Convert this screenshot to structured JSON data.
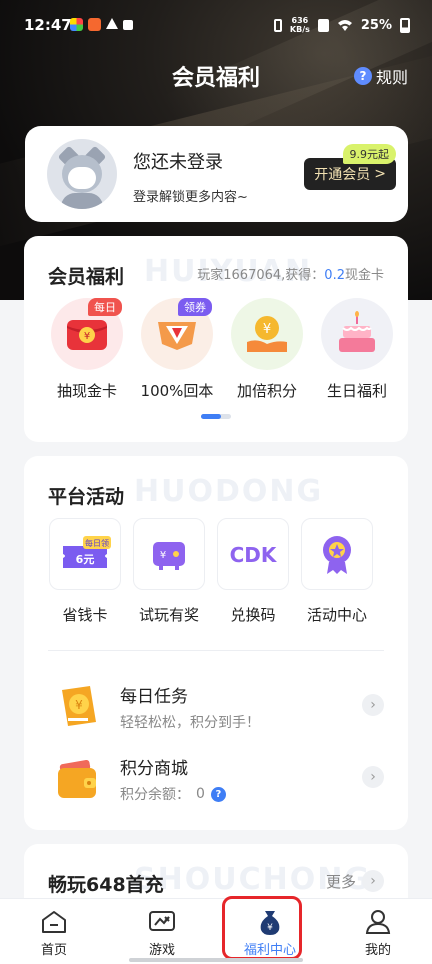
{
  "status_bar": {
    "time": "12:47",
    "net_speed_value": "636",
    "net_speed_unit": "KB/s",
    "battery": "25%"
  },
  "header": {
    "title": "会员福利",
    "rules_label": "规则",
    "rules_icon": "?"
  },
  "login_card": {
    "title": "您还未登录",
    "subtitle": "登录解锁更多内容~",
    "vip_price_tag": "9.9元起",
    "vip_button": "开通会员",
    "vip_button_chevron": ">"
  },
  "benefits": {
    "title": "会员福利",
    "watermark": "HUIYUAN",
    "note_prefix": "玩家1667064,获得：",
    "note_value": "0.2",
    "note_suffix": "现金卡",
    "items": [
      {
        "label": "抽现金卡",
        "badge": "每日",
        "icon": "red-envelope-icon"
      },
      {
        "label": "100%回本",
        "badge": "领券",
        "icon": "diamond-icon"
      },
      {
        "label": "加倍积分",
        "badge": "",
        "icon": "coin-hand-icon"
      },
      {
        "label": "生日福利",
        "badge": "",
        "icon": "birthday-cake-icon"
      }
    ],
    "page_indicator": {
      "current": 1,
      "total": 2
    }
  },
  "platform": {
    "title": "平台活动",
    "watermark": "HUODONG",
    "items": [
      {
        "label": "省钱卡",
        "badge": "每日领",
        "ticket_text": "6元",
        "icon": "ticket-icon"
      },
      {
        "label": "试玩有奖",
        "icon": "gamepad-icon"
      },
      {
        "label": "兑换码",
        "icon_text": "CDK",
        "icon": "cdk-icon"
      },
      {
        "label": "活动中心",
        "icon": "medal-icon"
      }
    ],
    "tasks": [
      {
        "title": "每日任务",
        "subtitle": "轻轻松松，积分到手！",
        "icon": "task-coin-icon"
      },
      {
        "title": "积分商城",
        "subtitle": "积分余额：",
        "balance": "0",
        "icon": "wallet-icon"
      }
    ],
    "chevron": "›",
    "help_icon": "?"
  },
  "first_charge": {
    "title": "畅玩648首充",
    "watermark": "SHOUCHONG",
    "more_label": "更多",
    "chevron": "›"
  },
  "tab_bar": {
    "tabs": [
      {
        "label": "首页",
        "icon": "home-icon"
      },
      {
        "label": "游戏",
        "icon": "game-icon"
      },
      {
        "label": "福利中心",
        "icon": "welfare-bag-icon",
        "active": true
      },
      {
        "label": "我的",
        "icon": "profile-icon"
      }
    ]
  },
  "colors": {
    "accent": "#3f7ef5",
    "hero_dark": "#1a1816",
    "vip_gold": "#f3e2b3",
    "highlight_red": "#e6262a",
    "badge_red": "#f0534e",
    "badge_purple": "#7b5cf0"
  }
}
